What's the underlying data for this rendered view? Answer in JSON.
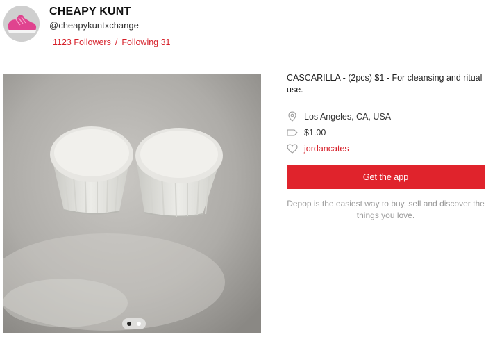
{
  "profile": {
    "name": "CHEAPY KUNT",
    "handle": "@cheapykuntxchange",
    "followers_label": "1123 Followers",
    "separator": "/",
    "following_label": "Following 31",
    "avatar_icon": "pink-sneaker-avatar"
  },
  "listing": {
    "description": "CASCARILLA - (2pcs) $1 - For cleansing and ritual use.",
    "location": "Los Angeles, CA, USA",
    "price": "$1.00",
    "liked_by": "jordancates",
    "photo_count": 2,
    "active_photo": 1
  },
  "cta": {
    "label": "Get the app"
  },
  "tagline": "Depop is the easiest way to buy, sell and discover the things you love.",
  "colors": {
    "accent": "#e0232c",
    "link": "#d6202a",
    "muted": "#9a9a9a"
  }
}
